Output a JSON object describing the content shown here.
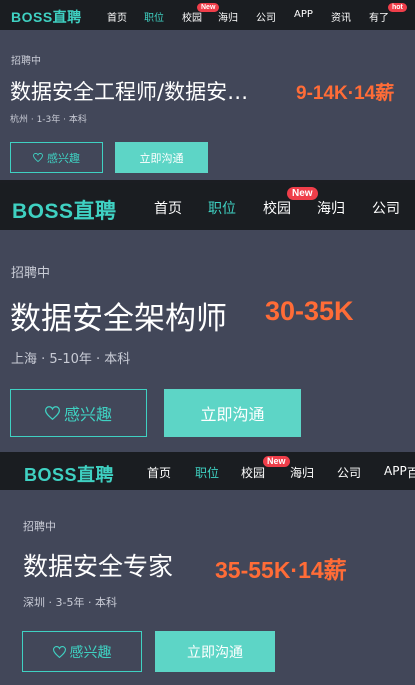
{
  "colors": {
    "accent": "#3fd1c2",
    "salary": "#ff6c37",
    "badge": "#ef3e4a",
    "panel": "#424759",
    "nav": "#1a1d21"
  },
  "cards": [
    {
      "nav": {
        "logo": "BOSS直聘",
        "items": [
          "首页",
          "职位",
          "校园",
          "海归",
          "公司",
          "APP",
          "资讯",
          "有了"
        ],
        "badge_new": "New",
        "badge_hot": "hot"
      },
      "status": "招聘中",
      "title": "数据安全工程师/数据安…",
      "salary": "9-14K·14薪",
      "meta": "杭州 · 1-3年 · 本科",
      "fav_label": "感兴趣",
      "chat_label": "立即沟通"
    },
    {
      "nav": {
        "logo": "BOSS直聘",
        "items": [
          "首页",
          "职位",
          "校园",
          "海归",
          "公司"
        ],
        "badge_new": "New"
      },
      "status": "招聘中",
      "title": "数据安全架构师",
      "salary": "30-35K",
      "meta": "上海 · 5-10年 · 本科",
      "fav_label": "感兴趣",
      "chat_label": "立即沟通"
    },
    {
      "nav": {
        "logo": "BOSS直聘",
        "items": [
          "首页",
          "职位",
          "校园",
          "海归",
          "公司",
          "APP",
          "百"
        ],
        "badge_new": "New"
      },
      "status": "招聘中",
      "title": "数据安全专家",
      "salary": "35-55K·14薪",
      "meta": "深圳 · 3-5年 · 本科",
      "fav_label": "感兴趣",
      "chat_label": "立即沟通"
    }
  ]
}
